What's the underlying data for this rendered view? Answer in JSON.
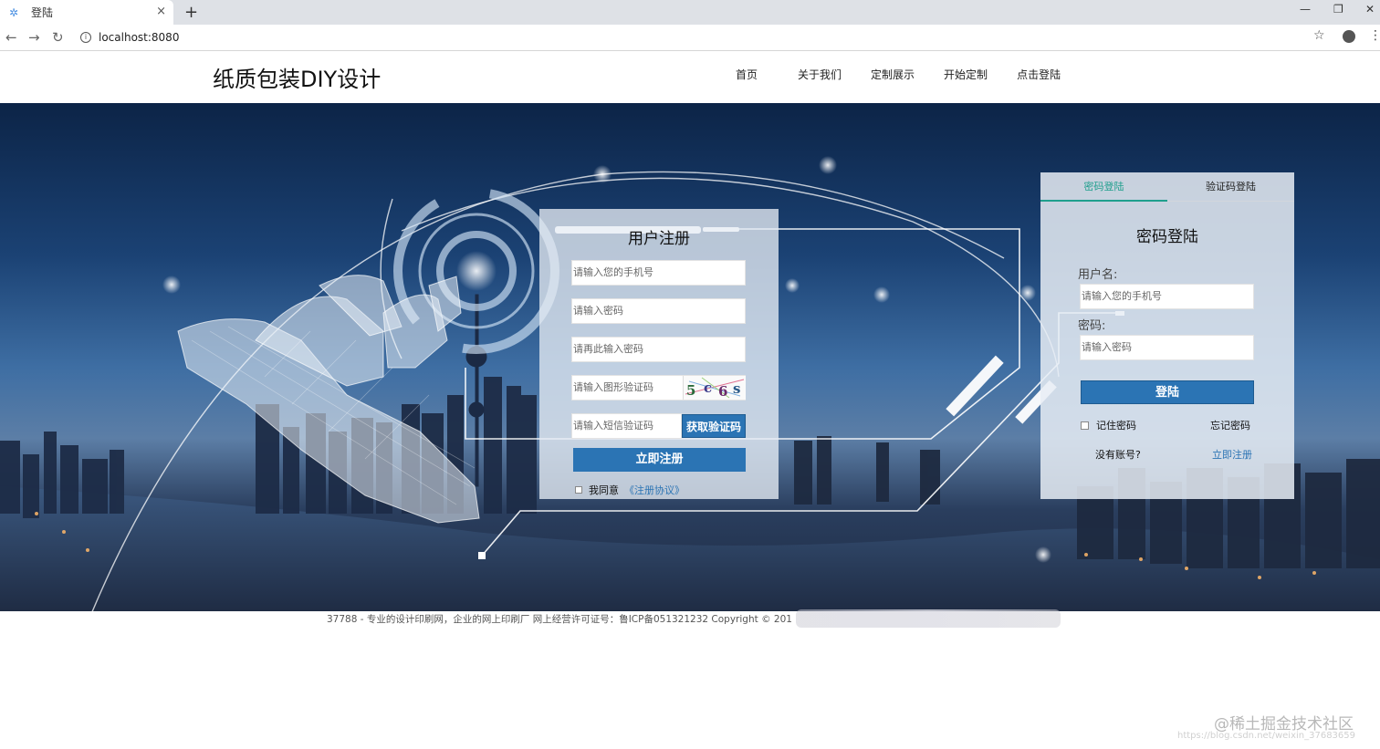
{
  "browser": {
    "tab_title": "登陆",
    "tab_close": "×",
    "new_tab": "+",
    "url": "localhost:8080",
    "back": "←",
    "forward": "→",
    "reload": "↻",
    "star": "☆",
    "menu": "⋮",
    "minimize": "—",
    "maximize": "❐",
    "close": "✕"
  },
  "site": {
    "logo": "纸质包装DIY设计",
    "nav": [
      "首页",
      "关于我们",
      "定制展示",
      "开始定制",
      "点击登陆"
    ]
  },
  "register": {
    "title": "用户注册",
    "phone_placeholder": "请输入您的手机号",
    "password_placeholder": "请输入密码",
    "confirm_placeholder": "请再此输入密码",
    "image_code_placeholder": "请输入图形验证码",
    "captcha_text": "5 c 6 s",
    "sms_code_placeholder": "请输入短信验证码",
    "sms_button": "获取验证码",
    "submit_button": "立即注册",
    "agree_text": "我同意",
    "agreement_link": "《注册协议》"
  },
  "login": {
    "tab_password": "密码登陆",
    "tab_sms": "验证码登陆",
    "title": "密码登陆",
    "username_label": "用户名:",
    "username_placeholder": "请输入您的手机号",
    "password_label": "密码:",
    "password_placeholder": "请输入密码",
    "submit_button": "登陆",
    "remember": "记住密码",
    "forgot": "忘记密码",
    "no_account": "没有账号?",
    "register_link": "立即注册"
  },
  "footer": {
    "text": "37788 - 专业的设计印刷网，企业的网上印刷厂 网上经营许可证号：鲁ICP备051321232 Copyright © 201"
  },
  "watermark": {
    "text": "@稀土掘金技术社区",
    "url": "https://blog.csdn.net/weixin_37683659"
  },
  "colors": {
    "accent": "#2b74b4",
    "tab_active": "#1f9f8d"
  }
}
